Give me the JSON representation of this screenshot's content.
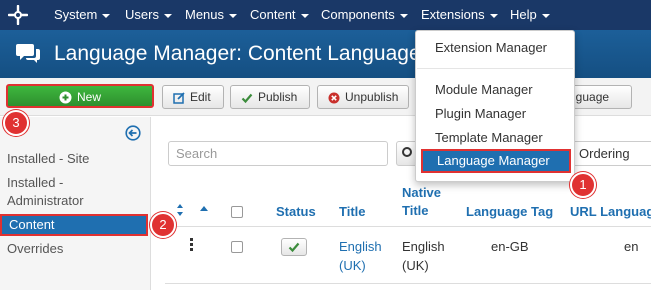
{
  "nav": {
    "items": [
      {
        "label": "System"
      },
      {
        "label": "Users"
      },
      {
        "label": "Menus"
      },
      {
        "label": "Content"
      },
      {
        "label": "Components"
      },
      {
        "label": "Extensions"
      },
      {
        "label": "Help"
      }
    ]
  },
  "header": {
    "title": "Language Manager: Content Languages"
  },
  "toolbar": {
    "new_label": "New",
    "edit_label": "Edit",
    "publish_label": "Publish",
    "unpublish_label": "Unpublish",
    "language_label": "nguage"
  },
  "sidebar": {
    "items": [
      {
        "label": "Installed - Site"
      },
      {
        "label": "Installed - Administrator"
      },
      {
        "label": "Content"
      },
      {
        "label": "Overrides"
      }
    ]
  },
  "filters": {
    "search_placeholder": "Search",
    "ordering_label": "Ordering"
  },
  "table": {
    "columns": {
      "status": "Status",
      "title": "Title",
      "native_title": "Native Title",
      "language_tag": "Language Tag",
      "url_language": "URL Language"
    },
    "rows": [
      {
        "title": "English (UK)",
        "native_title": "English (UK)",
        "language_tag": "en-GB",
        "url_code": "en"
      }
    ]
  },
  "extensions_menu": {
    "items": [
      {
        "label": "Extension Manager"
      },
      {
        "label": "Module Manager"
      },
      {
        "label": "Plugin Manager"
      },
      {
        "label": "Template Manager"
      },
      {
        "label": "Language Manager"
      }
    ]
  },
  "callouts": [
    "1",
    "2",
    "3"
  ],
  "colors": {
    "nav_bg": "#1a3867",
    "header_bg": "#17568c",
    "accent": "#1f6fb0",
    "new_button": "#3eb73e",
    "callout": "#e03131"
  }
}
